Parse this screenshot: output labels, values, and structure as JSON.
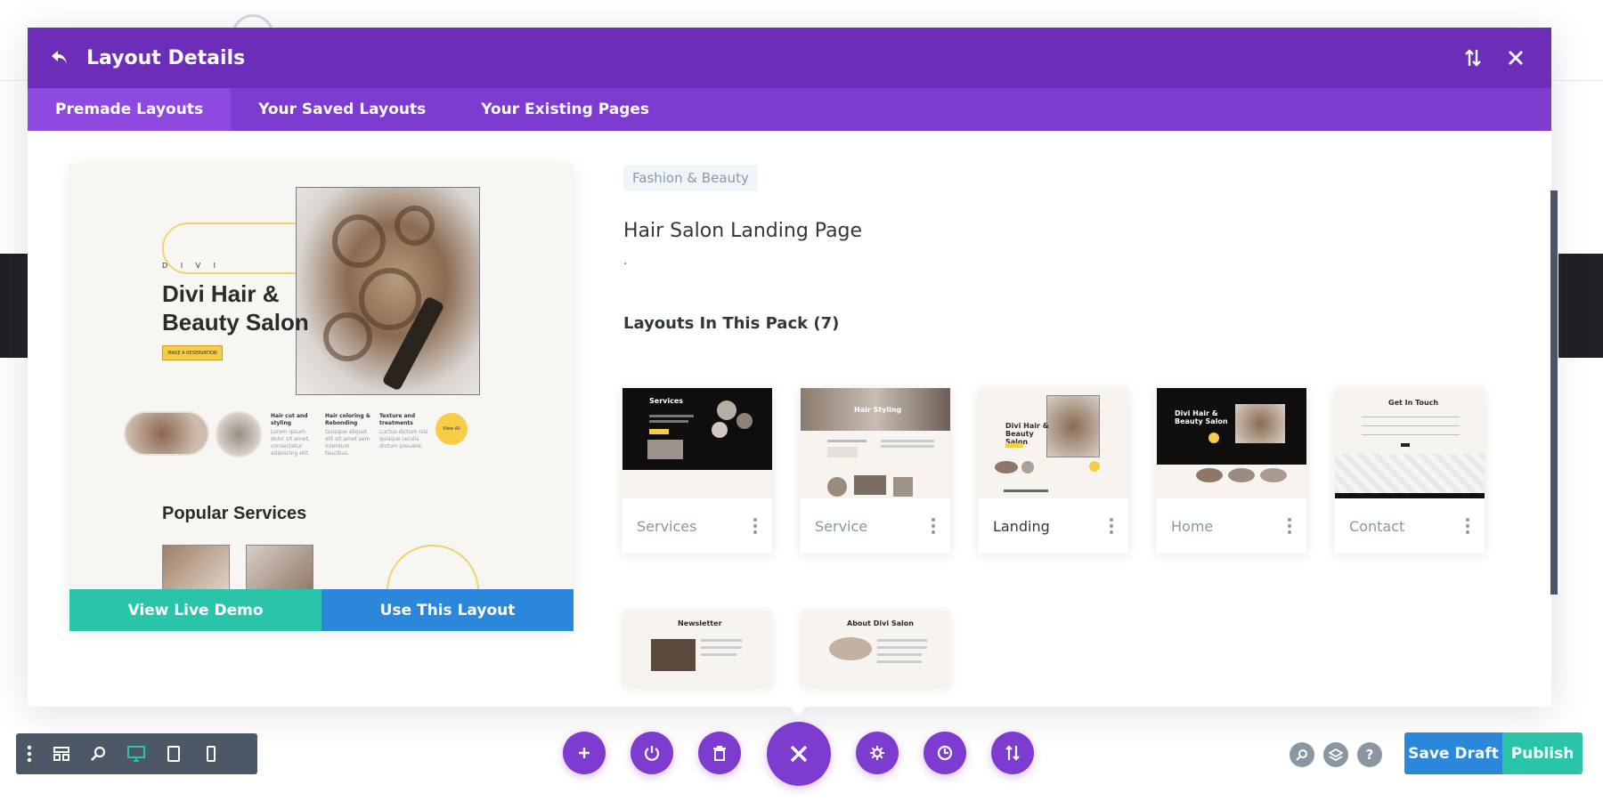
{
  "header": {
    "title": "Layout Details",
    "icons": {
      "back": "undo-arrow-icon",
      "sort": "sort-arrows-icon",
      "close": "close-icon"
    }
  },
  "tabs": [
    {
      "label": "Premade Layouts",
      "active": true
    },
    {
      "label": "Your Saved Layouts",
      "active": false
    },
    {
      "label": "Your Existing Pages",
      "active": false
    }
  ],
  "preview": {
    "kicker": "D I V I",
    "heading_line1": "Divi Hair &",
    "heading_line2": "Beauty Salon",
    "cta": "MAKE A RESERVATION",
    "services": [
      {
        "title": "Hair cut and styling",
        "text": "Lorem ipsum dolor sit amet, consectetur adipiscing elit."
      },
      {
        "title": "Hair coloring & Rebonding",
        "text": "Quisque aliquet elit sit amet sem interdum faucibus."
      },
      {
        "title": "Texture and treatments",
        "text": "Luctus dictum nisi quisque iaculis dictum posuere."
      }
    ],
    "view_all": "View All",
    "popular": "Popular Services",
    "btn_demo": "View Live Demo",
    "btn_use": "Use This Layout"
  },
  "details": {
    "category": "Fashion & Beauty",
    "title": "Hair Salon Landing Page",
    "description": ".",
    "pack_title": "Layouts In This Pack (7)"
  },
  "pack": [
    {
      "label": "Services",
      "thumb_title": "Services",
      "active": false
    },
    {
      "label": "Service",
      "thumb_title": "Hair Styling",
      "active": false
    },
    {
      "label": "Landing",
      "thumb_title": "Divi Hair & Beauty Salon",
      "active": true
    },
    {
      "label": "Home",
      "thumb_title": "Divi Hair & Beauty Salon",
      "active": false
    },
    {
      "label": "Contact",
      "thumb_title": "Get In Touch",
      "active": false
    },
    {
      "label": "",
      "thumb_title": "Newsletter",
      "active": false
    },
    {
      "label": "",
      "thumb_title": "About Divi Salon",
      "active": false
    }
  ],
  "bottom": {
    "left_tools": [
      "more-dots-icon",
      "wireframe-icon",
      "zoom-icon",
      "desktop-icon",
      "tablet-icon",
      "phone-icon"
    ],
    "center_tools": [
      "add-icon",
      "power-icon",
      "trash-icon",
      "close-icon",
      "gear-icon",
      "history-icon",
      "sort-icon"
    ],
    "right_tools": [
      "search-icon",
      "layers-icon",
      "help-icon"
    ],
    "help_glyph": "?",
    "save_draft": "Save Draft",
    "publish": "Publish"
  },
  "colors": {
    "header_purple": "#6c2eb9",
    "tabs_purple": "#7d3bcf",
    "teal": "#29c4a9",
    "blue": "#2b87da"
  }
}
